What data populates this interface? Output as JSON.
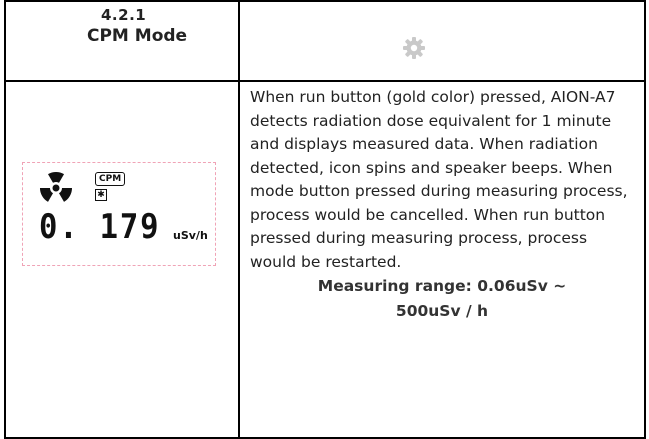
{
  "section": {
    "number": "4.2.1",
    "title": "CPM Mode",
    "icon": "gear-icon"
  },
  "display": {
    "badge": "CPM",
    "value": "0. 179",
    "unit": "uSv/h",
    "icons": [
      "radiation-icon",
      "speaker-icon"
    ]
  },
  "description": "When run button (gold color) pressed, AION-A7 detects radiation dose equivalent for 1 minute and displays measured data. When radiation detected, icon spins and speaker beeps. When mode button pressed during measuring process, process would be cancelled. When run button pressed during measuring process, process would be restarted.",
  "range": {
    "line1": "Measuring range: 0.06uSv ~",
    "line2": "500uSv / h"
  },
  "colors": {
    "border": "#000000",
    "lcd_border": "#f0a3b6",
    "gear": "#c9c9c9"
  }
}
